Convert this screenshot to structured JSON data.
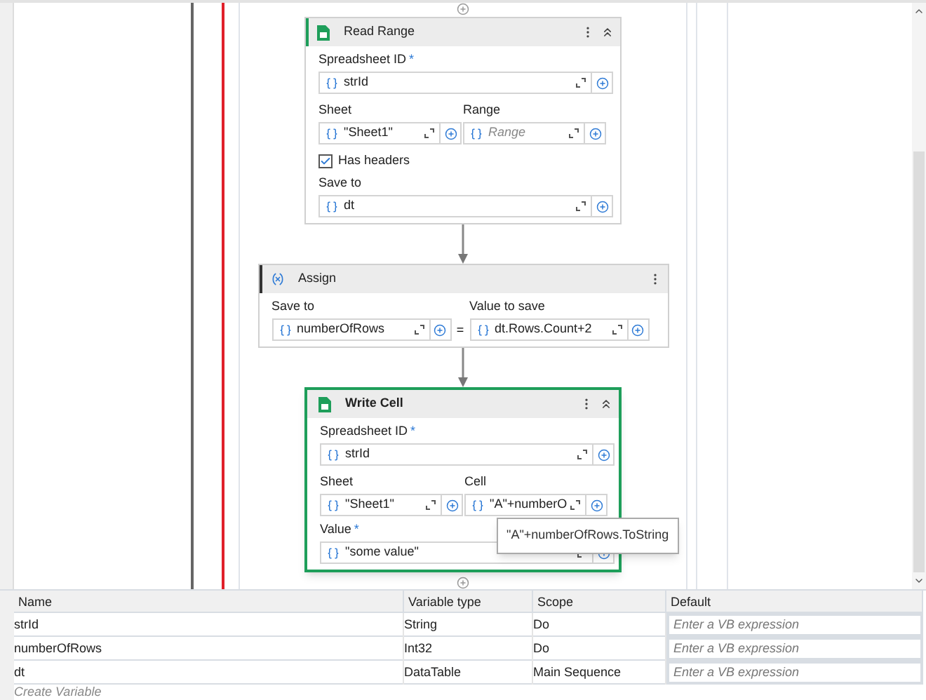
{
  "activities": [
    {
      "kind": "sheet",
      "title": "Read Range",
      "selected": false,
      "collapsible": true,
      "rows": [
        {
          "kind": "field",
          "label": "Spreadsheet ID",
          "required": "*",
          "value": "strId"
        },
        {
          "kind": "pair",
          "fields": [
            {
              "label": "Sheet",
              "value": "\"Sheet1\""
            },
            {
              "label": "Range",
              "placeholder": "Range"
            }
          ]
        },
        {
          "kind": "checkbox",
          "label": "Has headers",
          "checked": true
        },
        {
          "kind": "field",
          "label": "Save to",
          "value": "dt"
        }
      ]
    },
    {
      "kind": "assign",
      "title": "Assign",
      "selected": false,
      "collapsible": false,
      "rows": [
        {
          "kind": "assign",
          "operator": "=",
          "fields": [
            {
              "label": "Save to",
              "value": "numberOfRows"
            },
            {
              "label": "Value to save",
              "value": "dt.Rows.Count+2"
            }
          ]
        }
      ]
    },
    {
      "kind": "sheet",
      "title": "Write Cell",
      "selected": true,
      "collapsible": true,
      "tooltip": "\"A\"+numberOfRows.ToString",
      "rows": [
        {
          "kind": "field",
          "label": "Spreadsheet ID",
          "required": "*",
          "value": "strId"
        },
        {
          "kind": "pair",
          "fields": [
            {
              "label": "Sheet",
              "value": "\"Sheet1\""
            },
            {
              "label": "Cell",
              "value": "\"A\"+numberO"
            }
          ]
        },
        {
          "kind": "field",
          "label": "Value",
          "required": "*",
          "value": "\"some value\""
        }
      ]
    }
  ],
  "variables": {
    "columns": [
      "Name",
      "Variable type",
      "Scope",
      "Default"
    ],
    "rows": [
      {
        "name": "strId",
        "type": "String",
        "scope": "Do",
        "default_placeholder": "Enter a VB expression"
      },
      {
        "name": "numberOfRows",
        "type": "Int32",
        "scope": "Do",
        "default_placeholder": "Enter a VB expression"
      },
      {
        "name": "dt",
        "type": "DataTable",
        "scope": "Main Sequence",
        "default_placeholder": "Enter a VB expression"
      }
    ],
    "create_variable": "Create Variable"
  }
}
